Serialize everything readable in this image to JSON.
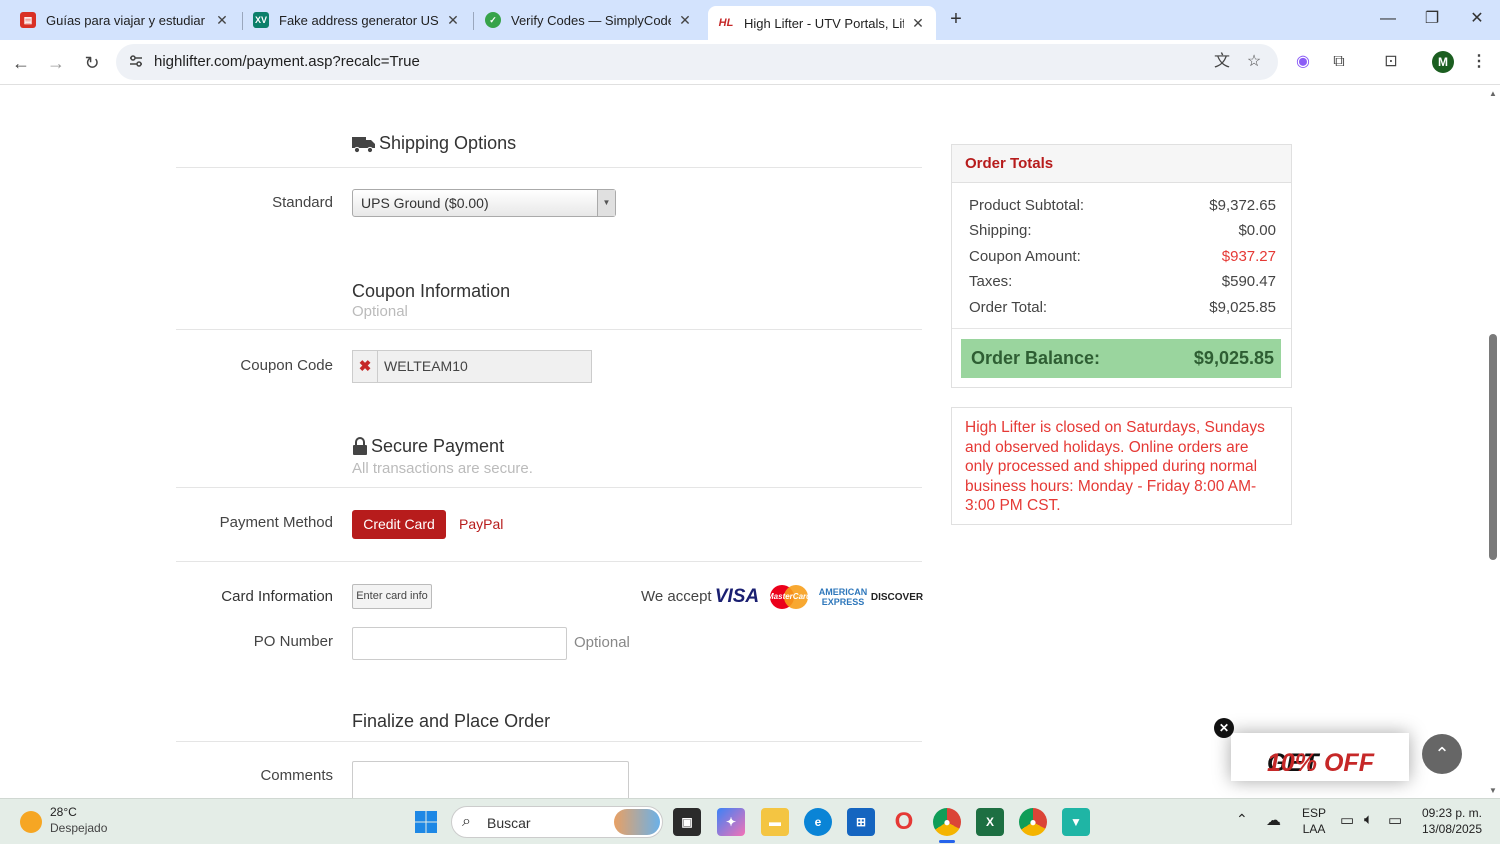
{
  "browser": {
    "tabs": [
      {
        "title": "Guías para viajar y estudiar en N",
        "icon": "book-icon",
        "color": "#d93025"
      },
      {
        "title": "Fake address generator US - Ra",
        "icon": "xv-icon",
        "color": "#0b7f6a"
      },
      {
        "title": "Verify Codes — SimplyCodes",
        "icon": "simplycodes-icon",
        "color": "#37a34a"
      },
      {
        "title": "High Lifter - UTV Portals, Lift Ki",
        "icon": "highlifter-icon",
        "color": "#c62828"
      }
    ],
    "url": "highlifter.com/payment.asp?recalc=True",
    "profile_initial": "M"
  },
  "shipping": {
    "title": "Shipping Options",
    "label": "Standard",
    "selected": "UPS Ground ($0.00)"
  },
  "coupon": {
    "title": "Coupon Information",
    "subtitle": "Optional",
    "label": "Coupon Code",
    "code": "WELTEAM10",
    "remove_glyph": "✖"
  },
  "payment": {
    "title": "Secure Payment",
    "subtitle": "All transactions are secure.",
    "method_label": "Payment Method",
    "credit_card": "Credit Card",
    "paypal": "PayPal",
    "card_info_label": "Card Information",
    "card_button": "Enter card info",
    "we_accept": "We accept",
    "cards": [
      "VISA",
      "MasterCard",
      "AMERICAN EXPRESS",
      "DISCOVER"
    ],
    "po_label": "PO Number",
    "po_optional": "Optional"
  },
  "finalize": {
    "title": "Finalize and Place Order",
    "comments_label": "Comments"
  },
  "totals": {
    "title": "Order Totals",
    "rows": [
      {
        "label": "Product Subtotal:",
        "amount": "$9,372.65"
      },
      {
        "label": "Shipping:",
        "amount": "$0.00"
      },
      {
        "label": "Coupon Amount:",
        "amount": "$937.27"
      },
      {
        "label": "Taxes:",
        "amount": "$590.47"
      },
      {
        "label": "Order Total:",
        "amount": "$9,025.85"
      }
    ],
    "balance_label": "Order Balance:",
    "balance_amount": "$9,025.85"
  },
  "notice": "High Lifter is closed on Saturdays, Sundays and observed holidays. Online orders are only processed and shipped during normal business hours: Monday - Friday 8:00 AM-3:00 PM CST.",
  "promo": {
    "prefix": "GET ",
    "highlight": "10% OFF"
  },
  "taskbar": {
    "temperature": "28°C",
    "weather": "Despejado",
    "search_placeholder": "Buscar",
    "lang_top": "ESP",
    "lang_bottom": "LAA",
    "time": "09:23 p. m.",
    "date": "13/08/2025"
  }
}
